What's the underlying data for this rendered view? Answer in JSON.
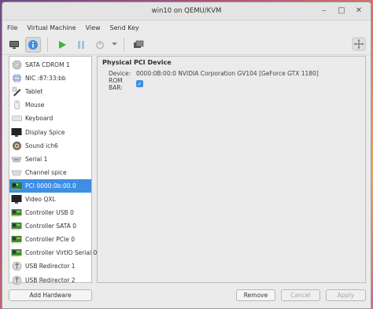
{
  "window": {
    "title": "win10 on QEMU/KVM"
  },
  "menu": [
    "File",
    "Virtual Machine",
    "View",
    "Send Key"
  ],
  "hardware": [
    {
      "label": "SATA CDROM 1",
      "icon": "cdrom-icon"
    },
    {
      "label": "NIC :87:33:bb",
      "icon": "network-icon"
    },
    {
      "label": "Tablet",
      "icon": "tablet-icon"
    },
    {
      "label": "Mouse",
      "icon": "mouse-icon"
    },
    {
      "label": "Keyboard",
      "icon": "keyboard-icon"
    },
    {
      "label": "Display Spice",
      "icon": "display-icon"
    },
    {
      "label": "Sound ich6",
      "icon": "sound-icon"
    },
    {
      "label": "Serial 1",
      "icon": "serial-icon"
    },
    {
      "label": "Channel spice",
      "icon": "channel-icon"
    },
    {
      "label": "PCI 0000:0b:00.0",
      "icon": "pci-icon",
      "selected": true
    },
    {
      "label": "Video QXL",
      "icon": "video-icon"
    },
    {
      "label": "Controller USB 0",
      "icon": "controller-icon"
    },
    {
      "label": "Controller SATA 0",
      "icon": "controller-icon"
    },
    {
      "label": "Controller PCIe 0",
      "icon": "controller-icon"
    },
    {
      "label": "Controller VirtIO Serial 0",
      "icon": "controller-icon"
    },
    {
      "label": "USB Redirector 1",
      "icon": "usb-redirector-icon"
    },
    {
      "label": "USB Redirector 2",
      "icon": "usb-redirector-icon"
    }
  ],
  "detail": {
    "title": "Physical PCI Device",
    "device_label": "Device:",
    "device_value": "0000:0B:00:0 NVIDIA Corporation GV104 [GeForce GTX 1180]",
    "rombar_label": "ROM BAR:",
    "rombar_checked": true
  },
  "buttons": {
    "add_hardware": "Add Hardware",
    "remove": "Remove",
    "cancel": "Cancel",
    "apply": "Apply"
  },
  "colors": {
    "selection": "#3d8ee4",
    "run_green": "#3bb33b"
  }
}
